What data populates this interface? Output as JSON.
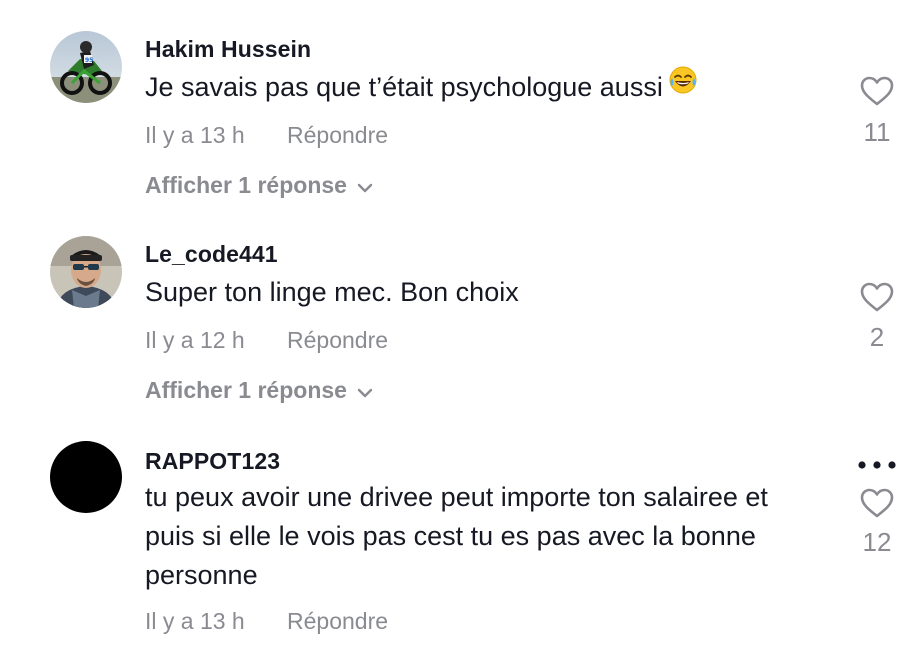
{
  "comments": [
    {
      "username": "Hakim Hussein",
      "text": "Je savais pas que t’était psychologue aussi",
      "emoji_icon": "face-with-tears-of-joy-icon",
      "time": "Il y a 13 h",
      "reply_label": "Répondre",
      "view_replies": "Afficher 1 réponse",
      "likes": "11",
      "avatar": "motocross-bike-photo"
    },
    {
      "username": "Le_code441",
      "text": "Super ton linge mec. Bon choix",
      "time": "Il y a 12 h",
      "reply_label": "Répondre",
      "view_replies": "Afficher 1 réponse",
      "likes": "2",
      "avatar": "man-with-sunglasses-photo"
    },
    {
      "username": "RAPPOT123",
      "text": "tu peux avoir une drivee peut importe ton salairee et puis si elle le vois pas cest tu es pas avec la bonne personne",
      "time": "Il y a 13 h",
      "reply_label": "Répondre",
      "likes": "12",
      "avatar": "black-circle",
      "more_icon": "more-options-icon"
    }
  ],
  "colors": {
    "primary_text": "#161823",
    "secondary_text": "#8a8b91",
    "icon": "#8a8b91"
  }
}
